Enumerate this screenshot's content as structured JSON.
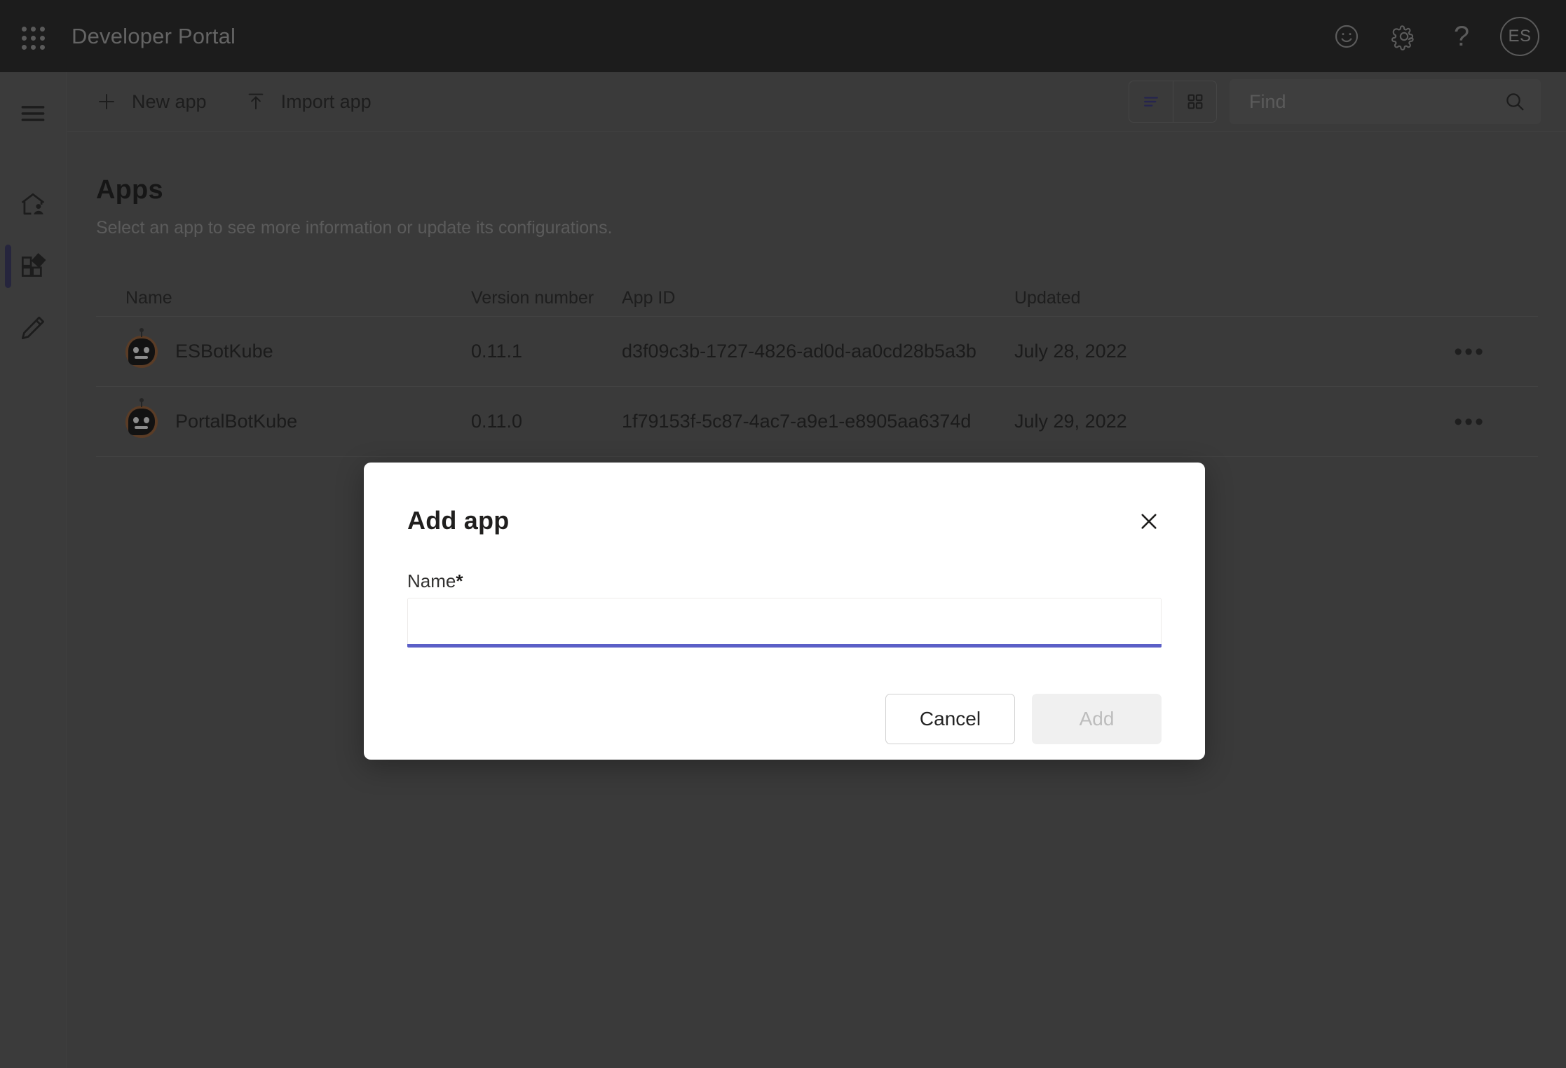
{
  "header": {
    "brand_title": "Developer Portal",
    "waffle_icon": "app-launcher-icon",
    "feedback_icon": "smiley-feedback-icon",
    "settings_icon": "gear-icon",
    "help_icon": "question-mark-icon",
    "help_glyph": "?",
    "avatar_initials": "ES"
  },
  "sidebar": {
    "items": [
      {
        "name": "hamburger-menu",
        "icon": "hamburger-menu-icon",
        "selected": false
      },
      {
        "name": "home",
        "icon": "home-person-icon",
        "selected": false
      },
      {
        "name": "apps",
        "icon": "apps-grid-icon",
        "selected": true
      },
      {
        "name": "edit",
        "icon": "pencil-edit-icon",
        "selected": false
      }
    ]
  },
  "toolbar": {
    "new_app_label": "New app",
    "new_app_icon": "plus-icon",
    "import_app_label": "Import app",
    "import_app_icon": "upload-arrow-icon",
    "view_list_icon": "list-view-icon",
    "view_grid_icon": "grid-view-icon",
    "active_view": "list",
    "search_placeholder": "Find",
    "search_value": "",
    "search_icon": "search-icon"
  },
  "main": {
    "title": "Apps",
    "subtitle": "Select an app to see more information or update its configurations.",
    "columns": [
      "Name",
      "Version number",
      "App ID",
      "Updated"
    ],
    "rows": [
      {
        "icon": "bot-avatar-icon",
        "name": "ESBotKube",
        "version": "0.11.1",
        "app_id": "d3f09c3b-1727-4826-ad0d-aa0cd28b5a3b",
        "updated": "July 28, 2022",
        "overflow": "•••"
      },
      {
        "icon": "bot-avatar-icon",
        "name": "PortalBotKube",
        "version": "0.11.0",
        "app_id": "1f79153f-5c87-4ac7-a9e1-e8905aa6374d",
        "updated": "July 29, 2022",
        "overflow": "•••"
      }
    ]
  },
  "modal": {
    "title": "Add app",
    "close_icon": "close-x-icon",
    "name_label": "Name",
    "name_required_mark": "*",
    "name_value": "",
    "name_placeholder": "",
    "cancel_label": "Cancel",
    "add_label": "Add",
    "add_disabled": true
  },
  "colors": {
    "header_bg": "#2b2b2b",
    "page_bg": "#5b5b5b",
    "accent_purple": "#5b5fc7",
    "rail_selected_bar": "#3b3a5e",
    "modal_bg": "#ffffff",
    "bot_avatar_bg": "#8a5c3b"
  }
}
